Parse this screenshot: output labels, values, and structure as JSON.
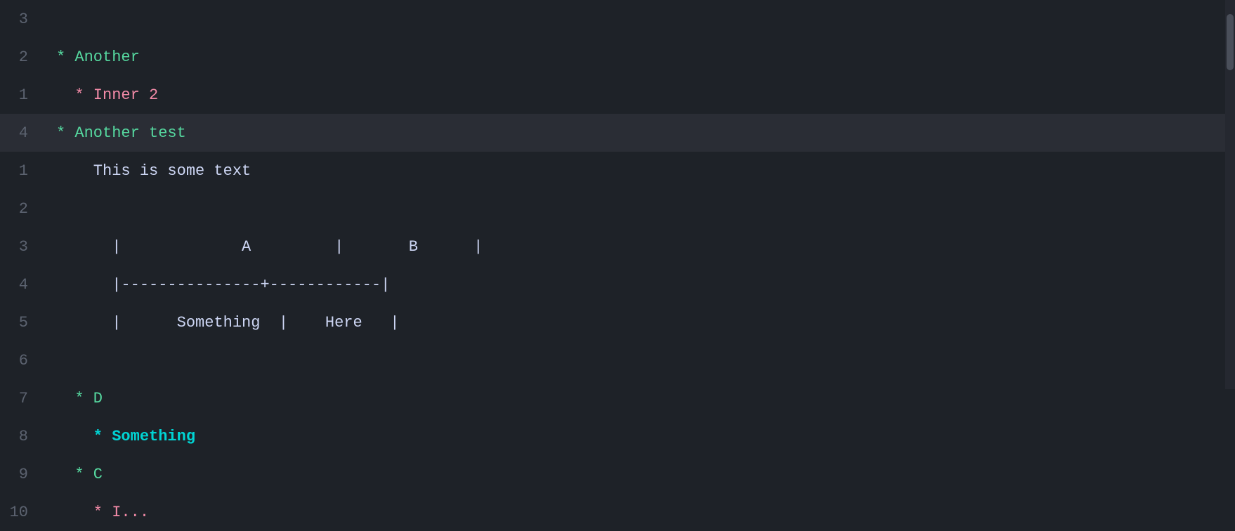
{
  "editor": {
    "background": "#1e2228",
    "highlight_line_bg": "#2a2d35",
    "lines": [
      {
        "number": "3",
        "content": "",
        "type": "empty",
        "highlighted": false
      },
      {
        "number": "2",
        "content": "* Another",
        "type": "heading",
        "color": "green",
        "highlighted": false
      },
      {
        "number": "1",
        "content": "  * Inner 2",
        "type": "subheading",
        "color": "pink",
        "highlighted": false
      },
      {
        "number": "4",
        "content": "* Another test",
        "type": "heading",
        "color": "green",
        "highlighted": true
      },
      {
        "number": "1",
        "content": "  This is some text",
        "type": "text",
        "color": "white",
        "highlighted": false
      },
      {
        "number": "2",
        "content": "",
        "type": "empty",
        "highlighted": false
      },
      {
        "number": "3",
        "content": "table",
        "type": "table-header",
        "highlighted": false,
        "table": {
          "headers": [
            "A",
            "B"
          ],
          "rows": [
            [
              "Something",
              "Here"
            ]
          ]
        }
      },
      {
        "number": "4",
        "content": "table-sep",
        "type": "table-sep",
        "highlighted": false
      },
      {
        "number": "5",
        "content": "table-data",
        "type": "table-data",
        "highlighted": false
      },
      {
        "number": "6",
        "content": "",
        "type": "empty",
        "highlighted": false
      },
      {
        "number": "7",
        "content": "  * D",
        "type": "subheading",
        "color": "green",
        "highlighted": false
      },
      {
        "number": "8",
        "content": "    * Something",
        "type": "subsubheading",
        "color": "cyan-bold",
        "highlighted": false
      },
      {
        "number": "9",
        "content": "  * C",
        "type": "subheading",
        "color": "green",
        "highlighted": false
      },
      {
        "number": "10",
        "content": "    * I...",
        "type": "subsubheading",
        "color": "pink",
        "highlighted": false
      }
    ]
  }
}
